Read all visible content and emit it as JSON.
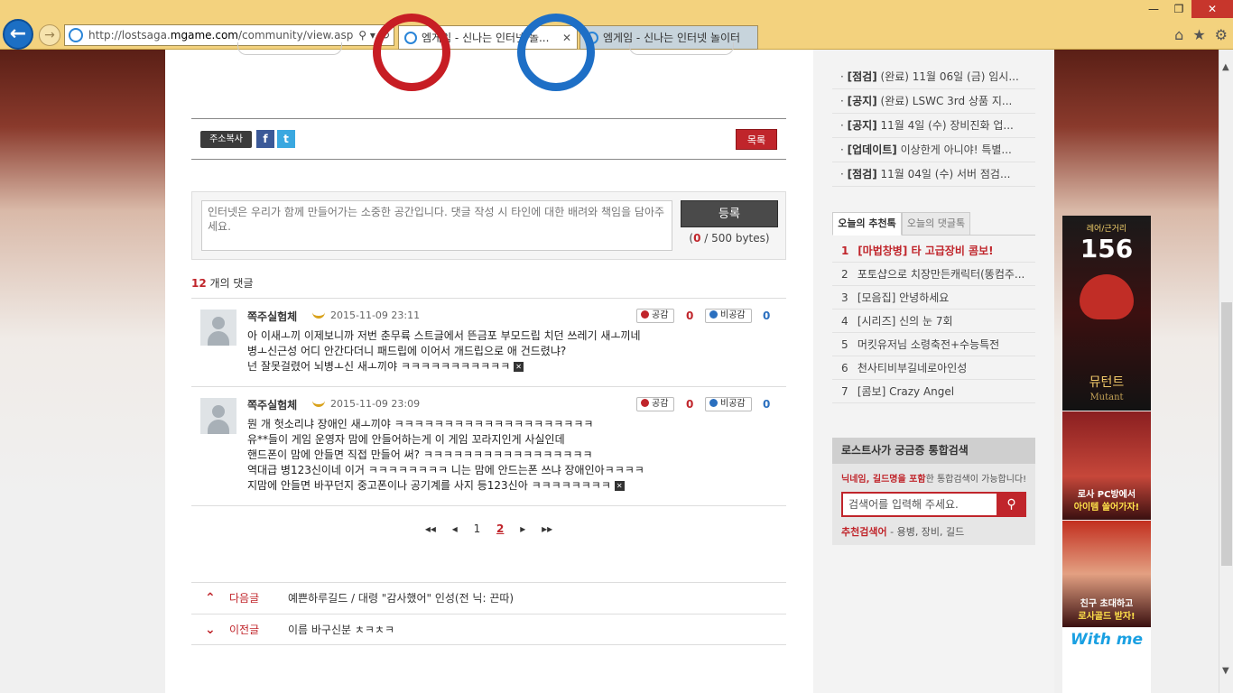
{
  "browser": {
    "url_prefix": "http://lostsaga.",
    "url_domain": "mgame.com",
    "url_path": "/community/view.asp?gr",
    "tabs": [
      {
        "label": "엠게임 - 신나는 인터넷 놀..."
      },
      {
        "label": "엠게임 - 신나는 인터넷 놀이터"
      }
    ],
    "search_tool": "⚲ ▾",
    "refresh": "↻",
    "tab_close": "✕"
  },
  "actions": {
    "copy_url": "주소복사",
    "facebook": "f",
    "twitter": "t",
    "list": "목록"
  },
  "comment_form": {
    "placeholder": "인터넷은 우리가 함께 만들어가는 소중한 공간입니다. 댓글 작성 시 타인에 대한 배려와 책임을 담아주세요.",
    "submit": "등록",
    "bytes_used": "0",
    "bytes_max": "/ 500 bytes)"
  },
  "comments_count": {
    "num": "12",
    "label": "개의 댓글"
  },
  "votes": {
    "up_label": "공감",
    "down_label": "비공감"
  },
  "comments": [
    {
      "author": "쪽주실험체",
      "date": "2015-11-09 23:11",
      "up": "0",
      "down": "0",
      "body": "아 이새ㅗ끼 이제보니까 저번 춘무륙 스트글에서 뜬금포 부모드립 치던 쓰레기 새ㅗ끼네\n병ㅗ신근성 어디 안간다더니 패드립에 이어서 개드립으로 애 건드렸냐?\n넌 잘못걸렸어 뇌병ㅗ신 새ㅗ끼야 ㅋㅋㅋㅋㅋㅋㅋㅋㅋㅋㅋ "
    },
    {
      "author": "쪽주실험체",
      "date": "2015-11-09 23:09",
      "up": "0",
      "down": "0",
      "body": "뭔 개 헛소리냐 장애인 새ㅗ끼야 ㅋㅋㅋㅋㅋㅋㅋㅋㅋㅋㅋㅋㅋㅋㅋㅋㅋㅋㅋㅋ\n유**들이 게임 운영자 맘에 안들어하는게 이 게임 꼬라지인게 사실인데\n핸드폰이 맘에 안들면 직접 만들어 써? ㅋㅋㅋㅋㅋㅋㅋㅋㅋㅋㅋㅋㅋㅋㅋㅋㅋ\n역대급 병123신이네 이거 ㅋㅋㅋㅋㅋㅋㅋㅋ 니는 맘에 안드는폰 쓰냐 장애인아ㅋㅋㅋㅋ\n지맘에 안들면 바꾸던지 중고폰이나 공기계를 사지 등123신아 ㅋㅋㅋㅋㅋㅋㅋㅋ "
    }
  ],
  "pager": {
    "first": "◂◂",
    "prev": "◂",
    "pages": [
      "1",
      "2"
    ],
    "next": "▸",
    "last": "▸▸"
  },
  "post_nav": [
    {
      "arrow": "⌃",
      "label": "다음글",
      "title": "예쁜하루길드 / 대령 \"감사했어\" 인성(전 닉: 끈따)"
    },
    {
      "arrow": "⌄",
      "label": "이전글",
      "title": "이름 바구신분 ㅊㅋㅊㅋ"
    }
  ],
  "notices": [
    {
      "tag": "[점검]",
      "text": "(완료) 11월 06일 (금) 임시..."
    },
    {
      "tag": "[공지]",
      "text": "(완료) LSWC 3rd 상품 지..."
    },
    {
      "tag": "[공지]",
      "text": "11월 4일 (수) 장비진화 업..."
    },
    {
      "tag": "[업데이트]",
      "text": "이상한게 아니야! 특별..."
    },
    {
      "tag": "[점검]",
      "text": "11월 04일 (수) 서버 점검..."
    }
  ],
  "rank_tabs": {
    "active": "오늘의 추천톡",
    "inactive": "오늘의 댓글톡"
  },
  "rank_list": [
    {
      "n": "1",
      "text": "[마법창병] 타 고급장비 콤보!"
    },
    {
      "n": "2",
      "text": "포토샵으로 치장만든캐릭터(똥컴주..."
    },
    {
      "n": "3",
      "text": "[모음집] 안녕하세요"
    },
    {
      "n": "4",
      "text": "[시리즈] 신의 눈 7회"
    },
    {
      "n": "5",
      "text": "머킷유저님 소령축전+수능특전"
    },
    {
      "n": "6",
      "text": "천사티비부길네로아인성"
    },
    {
      "n": "7",
      "text": "[콤보] Crazy Angel"
    }
  ],
  "search": {
    "title": "로스트사가 궁금증 통합검색",
    "desc_bold": "닉네임, 길드명을 포함",
    "desc_rest": "한 통합검색이 가능합니다!",
    "placeholder": "검색어를 입력해 주세요.",
    "reco_label": "추천검색어",
    "reco_items": "- 용병, 장비, 길드"
  },
  "ad": {
    "line1": "레어/근거리",
    "line2": "156",
    "line3": "뮤턴트",
    "line4": "Mutant",
    "b2_line1": "로사 PC방에서",
    "b2_line2": "아이템 쓸어가자!",
    "b3_line1": "친구 초대하고",
    "b3_line2": "로사골드 받자!",
    "b4": "With me"
  },
  "colors": {
    "accent": "#c0252b",
    "vote_down": "#2a6fbf",
    "chrome": "#f3d27e"
  }
}
